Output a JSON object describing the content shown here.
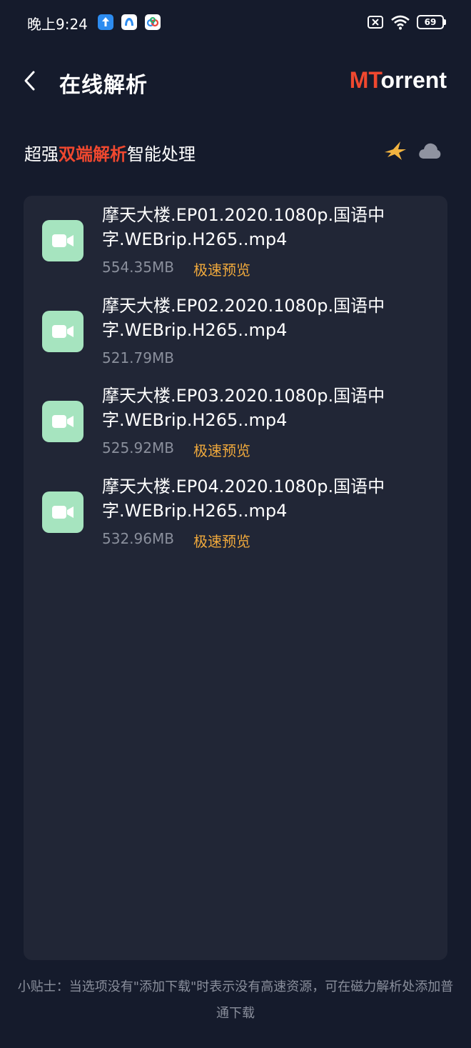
{
  "status_bar": {
    "time": "晚上9:24",
    "battery_level": "69"
  },
  "header": {
    "title": "在线解析",
    "brand_prefix": "MT",
    "brand_suffix": "orrent"
  },
  "subtitle": {
    "part1": "超强",
    "highlight": "双端解析",
    "part2": "智能处理"
  },
  "files": [
    {
      "name": "摩天大楼.EP01.2020.1080p.国语中字.WEBrip.H265..mp4",
      "size": "554.35MB",
      "preview": "极速预览"
    },
    {
      "name": "摩天大楼.EP02.2020.1080p.国语中字.WEBrip.H265..mp4",
      "size": "521.79MB",
      "preview": ""
    },
    {
      "name": "摩天大楼.EP03.2020.1080p.国语中字.WEBrip.H265..mp4",
      "size": "525.92MB",
      "preview": "极速预览"
    },
    {
      "name": "摩天大楼.EP04.2020.1080p.国语中字.WEBrip.H265..mp4",
      "size": "532.96MB",
      "preview": "极速预览"
    }
  ],
  "tip": "小贴士：当选项没有\"添加下载\"时表示没有高速资源，可在磁力解析处添加普通下载",
  "colors": {
    "background": "#151b2c",
    "card": "#212636",
    "accent_red": "#f0482f",
    "preview_orange": "#f0a93c",
    "thumb_green": "#a6e4bf"
  }
}
